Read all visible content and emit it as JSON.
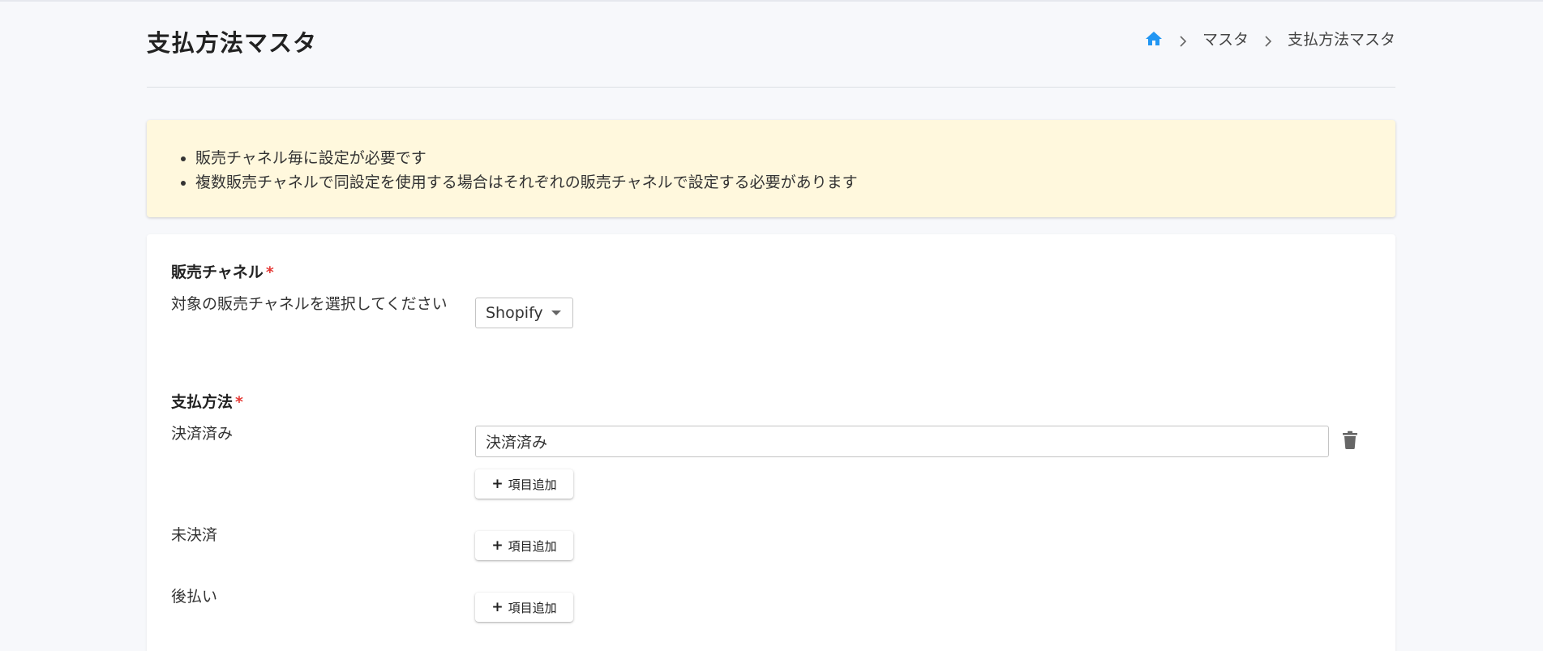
{
  "page": {
    "title": "支払方法マスタ"
  },
  "breadcrumb": {
    "home_icon": "home-icon",
    "items": [
      "マスタ",
      "支払方法マスタ"
    ]
  },
  "notice": {
    "items": [
      "販売チャネル毎に設定が必要です",
      "複数販売チャネルで同設定を使用する場合はそれぞれの販売チャネルで設定する必要があります"
    ]
  },
  "sales_channel": {
    "title": "販売チャネル",
    "required_mark": "*",
    "description": "対象の販売チャネルを選択してください",
    "selected": "Shopify"
  },
  "payment": {
    "title": "支払方法",
    "required_mark": "*",
    "add_label": "項目追加",
    "add_plus": "+",
    "groups": [
      {
        "label": "決済済み",
        "values": [
          "決済済み"
        ]
      },
      {
        "label": "未決済",
        "values": []
      },
      {
        "label": "後払い",
        "values": []
      }
    ]
  },
  "colors": {
    "accent": "#2196f3",
    "required": "#e53935",
    "notice_bg": "#fff8dd"
  }
}
